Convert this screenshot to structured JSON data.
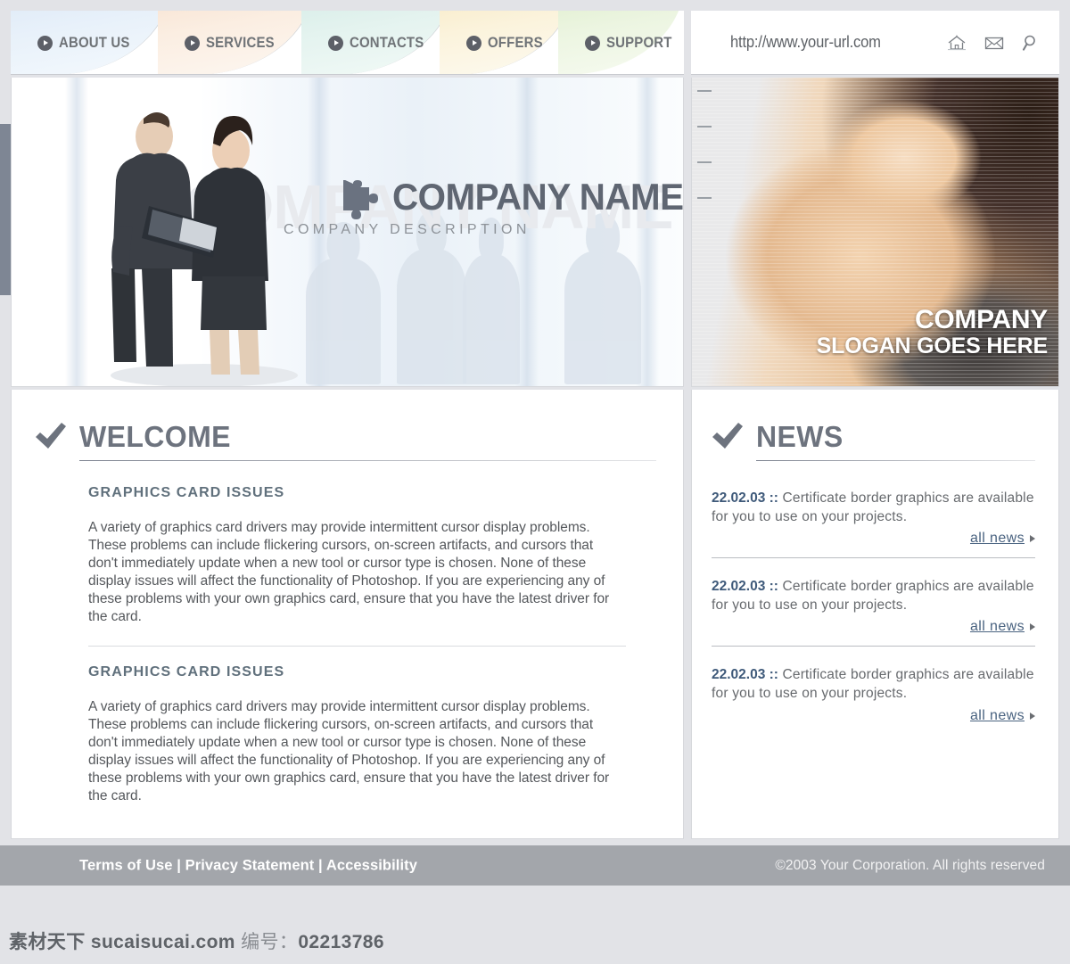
{
  "nav": {
    "items": [
      {
        "label": "ABOUT US",
        "icon": "play-circle-icon"
      },
      {
        "label": "SERVICES",
        "icon": "play-circle-icon"
      },
      {
        "label": "CONTACTS",
        "icon": "play-circle-icon"
      },
      {
        "label": "OFFERS",
        "icon": "play-circle-icon"
      },
      {
        "label": "SUPPORT",
        "icon": "play-circle-icon"
      }
    ]
  },
  "urlbar": {
    "url": "http://www.your-url.com",
    "icons": [
      {
        "name": "home-icon"
      },
      {
        "name": "mail-icon"
      },
      {
        "name": "search-icon"
      }
    ]
  },
  "banner": {
    "logo_icon": "puzzle-piece-icon",
    "company_name": "COMPANY NAME",
    "company_description": "COMPANY DESCRIPTION",
    "ghost_text": "COMPANY NAME",
    "slogan_line1": "COMPANY",
    "slogan_line2": "SLOGAN GOES HERE"
  },
  "welcome": {
    "icon": "checkmark-icon",
    "title": "WELCOME",
    "articles": [
      {
        "subhead": "GRAPHICS CARD ISSUES",
        "body": "A variety of graphics card drivers may provide intermittent cursor display problems. These problems can include flickering cursors, on-screen artifacts, and cursors that don't immediately update when a new tool or cursor type is chosen. None of these display issues will affect the functionality of Photoshop. If you are experiencing any of these problems with your own graphics card, ensure that you have the latest driver for the card."
      },
      {
        "subhead": "GRAPHICS CARD ISSUES",
        "body": "A variety of graphics card drivers may provide intermittent cursor display problems. These problems can include flickering cursors, on-screen artifacts, and cursors that don't immediately update when a new tool or cursor type is chosen. None of these display issues will affect the functionality of Photoshop. If you are experiencing any of these problems with your own graphics card, ensure that you have the latest driver for the card."
      }
    ]
  },
  "news": {
    "icon": "checkmark-icon",
    "title": "NEWS",
    "link_label": "all news",
    "items": [
      {
        "date": "22.02.03 ::",
        "text": " Certificate border graphics are available for you to use on your projects."
      },
      {
        "date": "22.02.03 ::",
        "text": " Certificate border graphics are available for you to use on your projects."
      },
      {
        "date": "22.02.03 ::",
        "text": " Certificate border graphics are available for you to use on your projects."
      }
    ]
  },
  "footer": {
    "links": "Terms of Use | Privacy Statement | Accessibility",
    "copyright": "©2003 Your Corporation. All rights reserved"
  },
  "watermark": {
    "cn": "素材天下",
    "site": "sucaisucai.com",
    "label": "编号：",
    "id": "02213786"
  },
  "colors": {
    "footer_bg": "#a3a6ab",
    "heading": "#6d737e",
    "link": "#4a6380",
    "page_bg": "#e2e3e7"
  }
}
